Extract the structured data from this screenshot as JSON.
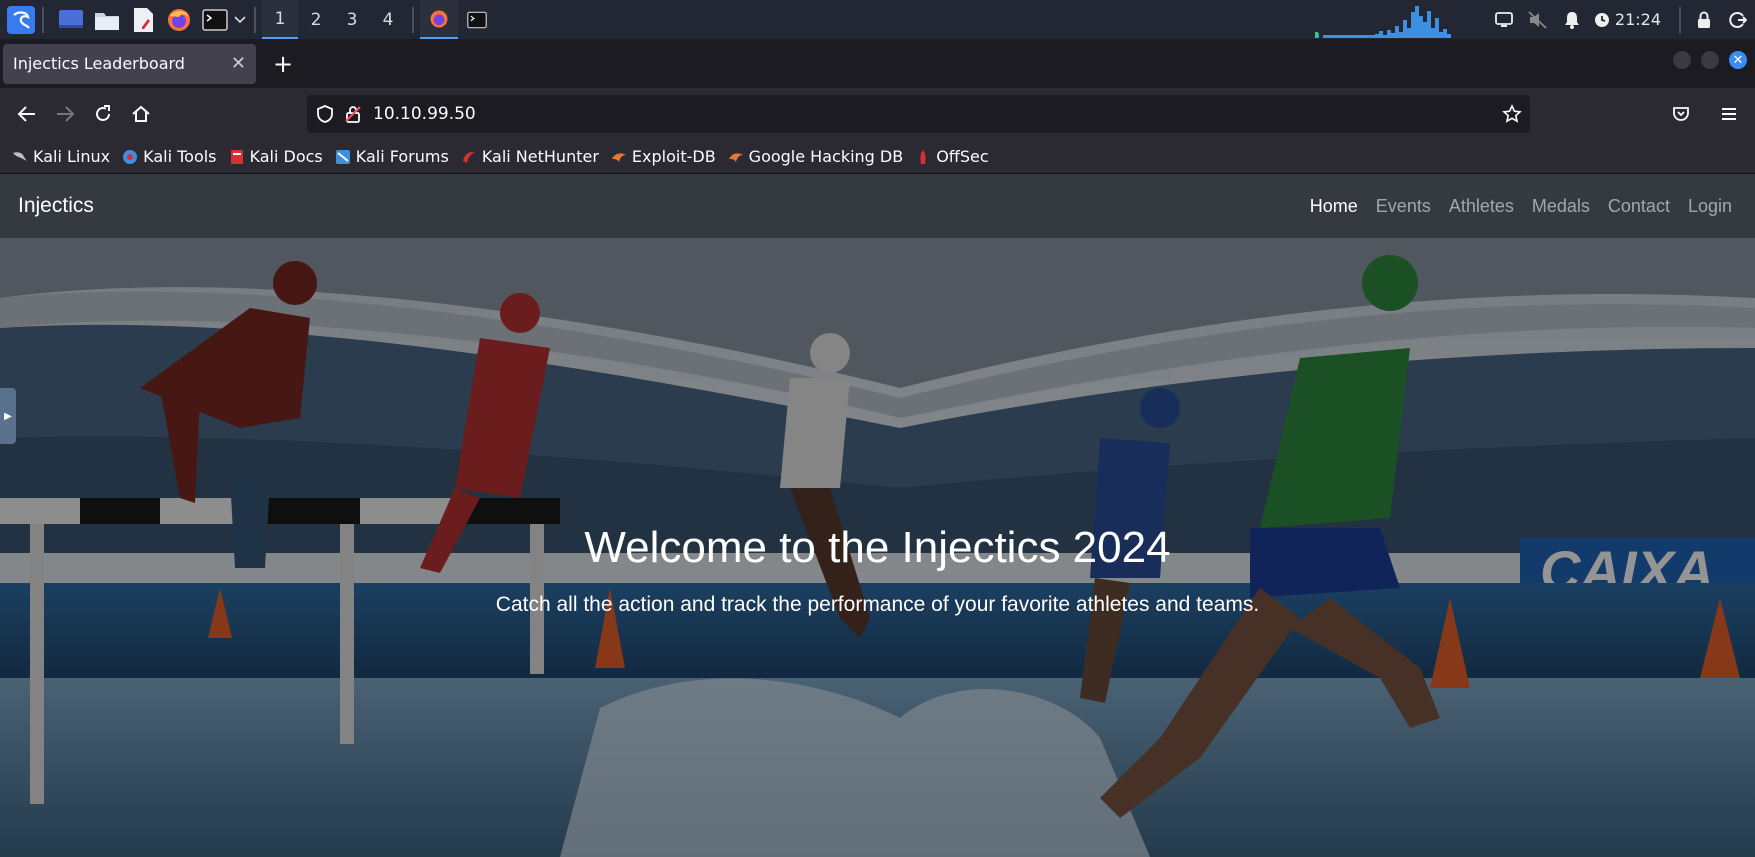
{
  "taskbar": {
    "workspaces": [
      "1",
      "2",
      "3",
      "4"
    ],
    "active_workspace": "1",
    "clock": "21:24",
    "icons": [
      "kali-menu-icon",
      "desktop-icon",
      "file-manager-icon",
      "text-editor-icon",
      "firefox-icon",
      "terminal-icon"
    ]
  },
  "browser": {
    "tab_title": "Injectics Leaderboard",
    "url": "10.10.99.50",
    "bookmarks": [
      {
        "label": "Kali Linux",
        "color": "#9aa6b2"
      },
      {
        "label": "Kali Tools",
        "color": "#3d8fe0"
      },
      {
        "label": "Kali Docs",
        "color": "#d83030"
      },
      {
        "label": "Kali Forums",
        "color": "#3d8fe0"
      },
      {
        "label": "Kali NetHunter",
        "color": "#d83030"
      },
      {
        "label": "Exploit-DB",
        "color": "#e8772e"
      },
      {
        "label": "Google Hacking DB",
        "color": "#e8772e"
      },
      {
        "label": "OffSec",
        "color": "#d83030"
      }
    ]
  },
  "site": {
    "brand": "Injectics",
    "menu": [
      "Home",
      "Events",
      "Athletes",
      "Medals",
      "Contact",
      "Login"
    ],
    "active_menu": "Home",
    "hero_title": "Welcome to the Injectics 2024",
    "hero_subtitle": "Catch all the action and track the performance of your favorite athletes and teams.",
    "hero_banner_text": "CAIXA"
  }
}
